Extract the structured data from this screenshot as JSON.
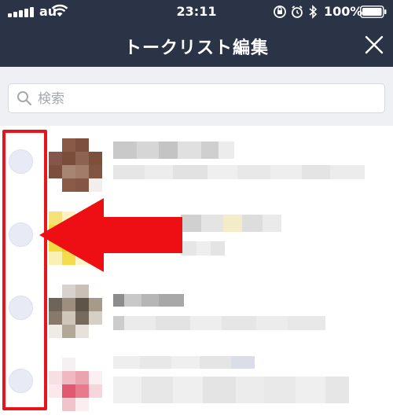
{
  "status_bar": {
    "carrier": "au",
    "time": "23:11",
    "battery": "100%"
  },
  "nav": {
    "title": "トークリスト編集",
    "close_icon": "close-icon"
  },
  "search": {
    "placeholder": "検索",
    "value": "",
    "icon": "search-icon"
  },
  "chat_list": {
    "row_count": 4,
    "content_note": "names, messages and avatars are pixelated"
  },
  "annotation": {
    "highlight_color": "#e8141b",
    "arrow_color": "#ee0f14"
  }
}
